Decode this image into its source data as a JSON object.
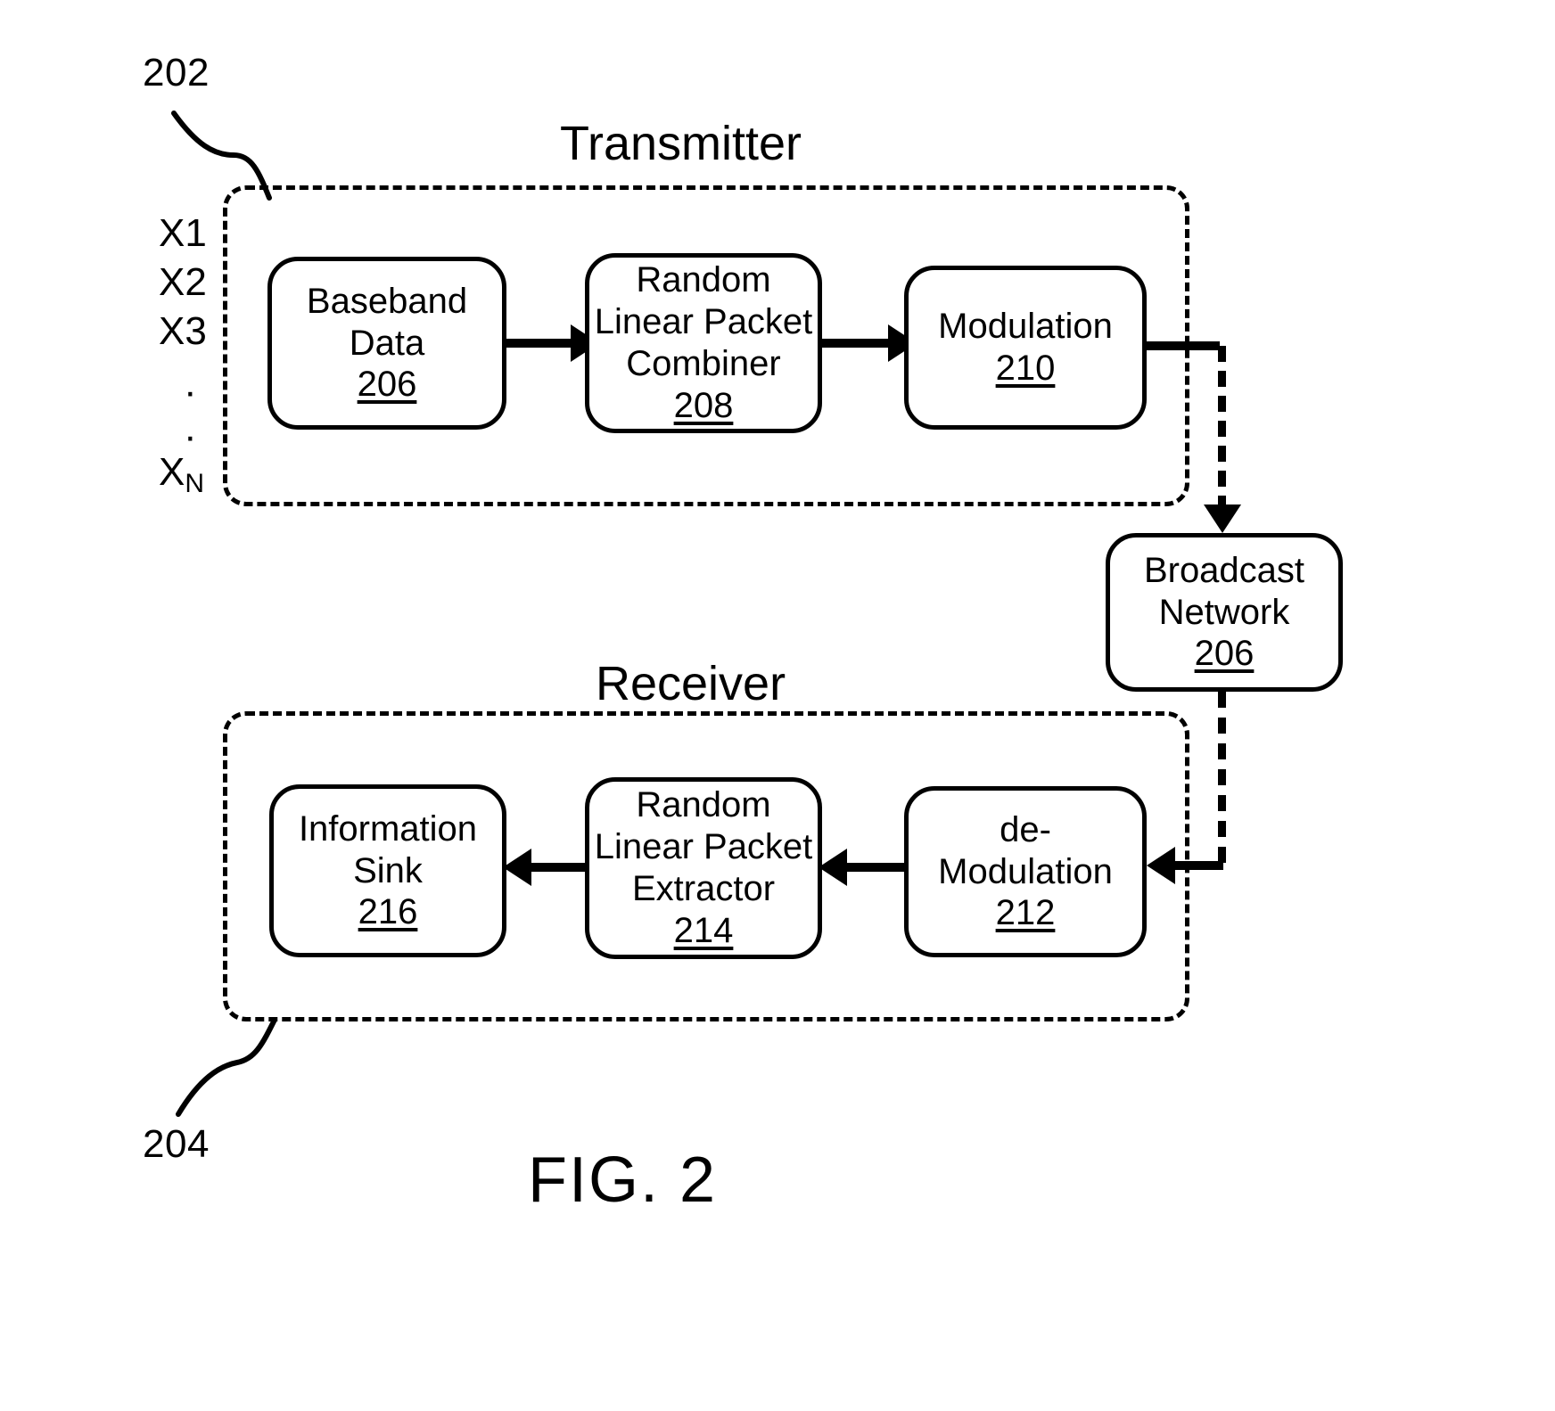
{
  "figure": {
    "caption": "FIG. 2"
  },
  "callouts": {
    "transmitter_ref": "202",
    "receiver_ref": "204"
  },
  "transmitter": {
    "title": "Transmitter",
    "inputs": [
      {
        "base": "X1",
        "sub": ""
      },
      {
        "base": "X2",
        "sub": ""
      },
      {
        "base": "X3",
        "sub": ""
      },
      {
        "base": "X",
        "sub": "N"
      }
    ],
    "ellipsis": "·",
    "blocks": [
      {
        "lines": [
          "Baseband",
          "Data"
        ],
        "refnum": "206"
      },
      {
        "lines": [
          "Random",
          "Linear Packet",
          "Combiner"
        ],
        "refnum": "208"
      },
      {
        "lines": [
          "Modulation"
        ],
        "refnum": "210"
      }
    ]
  },
  "network": {
    "lines": [
      "Broadcast",
      "Network"
    ],
    "refnum": "206"
  },
  "receiver": {
    "title": "Receiver",
    "blocks": [
      {
        "lines": [
          "Information",
          "Sink"
        ],
        "refnum": "216"
      },
      {
        "lines": [
          "Random",
          "Linear Packet",
          "Extractor"
        ],
        "refnum": "214"
      },
      {
        "lines": [
          "de-",
          "Modulation"
        ],
        "refnum": "212"
      }
    ]
  },
  "colors": {
    "ink": "#000000",
    "paper": "#ffffff"
  }
}
